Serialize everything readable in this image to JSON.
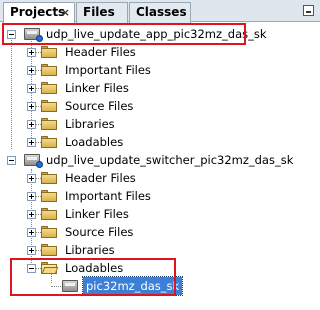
{
  "tabs": [
    {
      "label": "Projects",
      "close": "×"
    },
    {
      "label": "Files"
    },
    {
      "label": "Classes"
    }
  ],
  "projects": [
    {
      "name": "udp_live_update_app_pic32mz_das_sk",
      "folders": [
        "Header Files",
        "Important Files",
        "Linker Files",
        "Source Files",
        "Libraries",
        "Loadables"
      ]
    },
    {
      "name": "udp_live_update_switcher_pic32mz_das_sk",
      "folders": [
        "Header Files",
        "Important Files",
        "Linker Files",
        "Source Files",
        "Libraries",
        "Loadables"
      ],
      "loadable_child": "pic32mz_das_sk"
    }
  ],
  "highlight_color": "#e0141e",
  "selection_color": "#3c7fd6"
}
